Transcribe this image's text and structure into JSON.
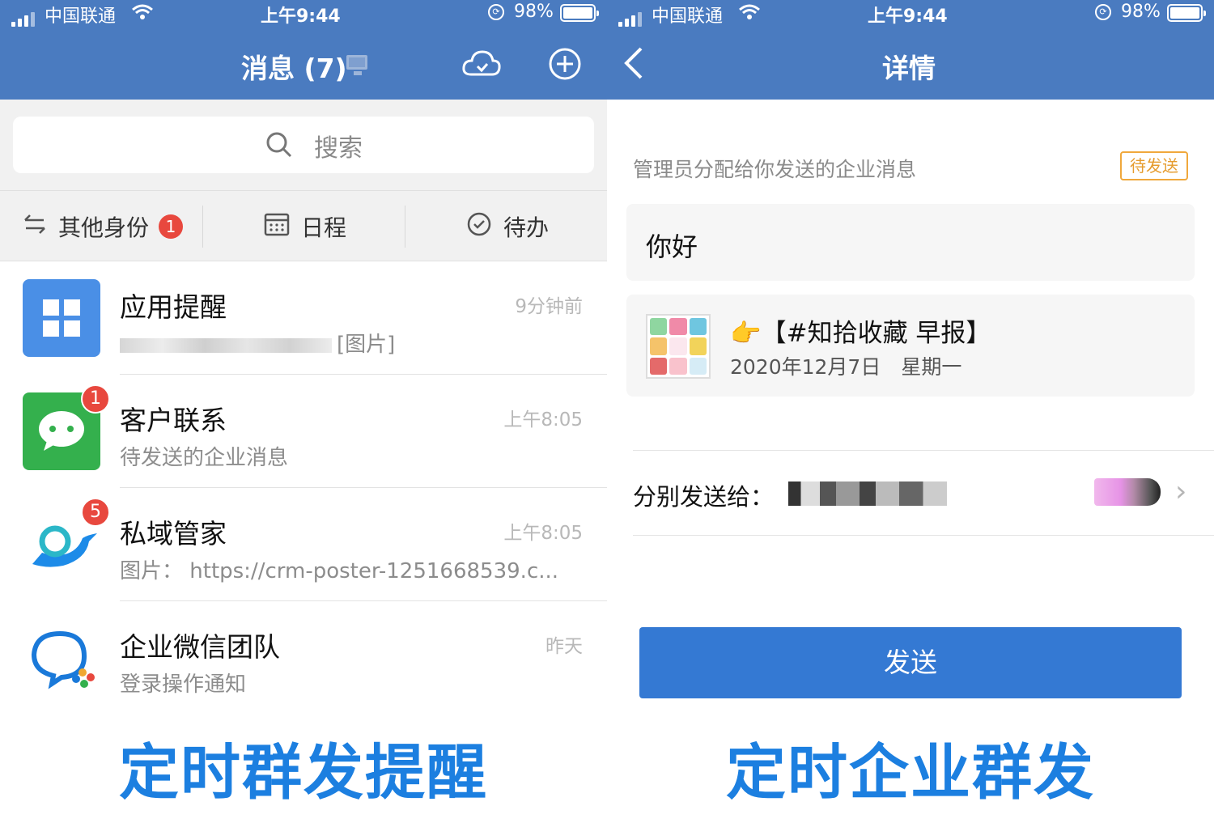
{
  "status_bar": {
    "carrier": "中国联通",
    "time": "上午9:44",
    "battery": "98%"
  },
  "left": {
    "title": "消息 (7)",
    "search_placeholder": "搜索",
    "tabs": [
      {
        "label": "其他身份",
        "badge": "1"
      },
      {
        "label": "日程"
      },
      {
        "label": "待办"
      }
    ],
    "messages": [
      {
        "title": "应用提醒",
        "subtitle": "[图片]",
        "time": "9分钟前",
        "icon": "app-grid-icon",
        "color": "#4a8fe6"
      },
      {
        "title": "客户联系",
        "subtitle": "待发送的企业消息",
        "time": "上午8:05",
        "badge": "1",
        "icon": "chat-bubble-icon",
        "color": "#34b04d"
      },
      {
        "title": "私域管家",
        "subtitle": "图片： https://crm-poster-1251668539.c...",
        "time": "上午8:05",
        "badge": "5",
        "icon": "bird-logo-icon",
        "color": "#1d8be8"
      },
      {
        "title": "企业微信团队",
        "subtitle": "登录操作通知",
        "time": "昨天",
        "icon": "wecom-logo-icon",
        "color": "#1a79d9"
      }
    ],
    "caption": "定时群发提醒"
  },
  "right": {
    "title": "详情",
    "info": "管理员分配给你发送的企业消息",
    "status_tag": "待发送",
    "message_text": "你好",
    "card": {
      "emoji": "👉",
      "title": "【#知拾收藏 早报】",
      "date": "2020年12月7日　星期一"
    },
    "send_to_label": "分别发送给：",
    "send_button": "发送",
    "caption": "定时企业群发"
  },
  "colors": {
    "nav": "#4a7bc0",
    "badge": "#e8483e",
    "accent": "#1c7fe0",
    "button": "#3479d3",
    "pending": "#e69c2e"
  }
}
